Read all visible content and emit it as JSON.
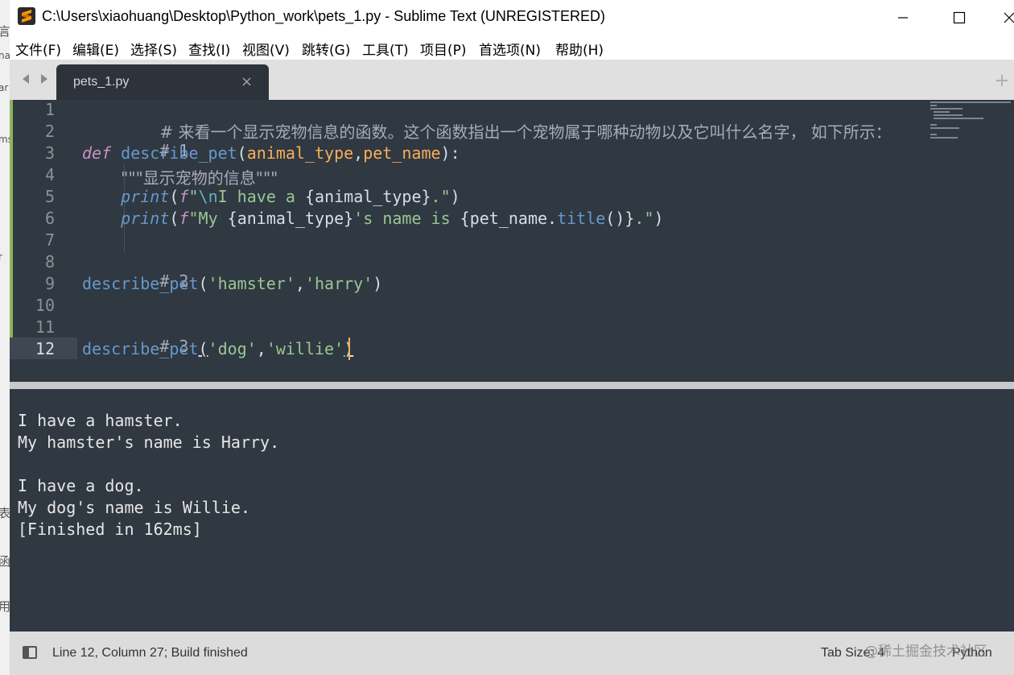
{
  "window": {
    "title": "C:\\Users\\xiaohuang\\Desktop\\Python_work\\pets_1.py - Sublime Text (UNREGISTERED)"
  },
  "menu": [
    "文件(F)",
    "编辑(E)",
    "选择(S)",
    "查找(I)",
    "视图(V)",
    "跳转(G)",
    "工具(T)",
    "项目(P)",
    "首选项(N)",
    "帮助(H)"
  ],
  "tab": {
    "label": "pets_1.py",
    "close": "×"
  },
  "editor": {
    "line_numbers": [
      "1",
      "2",
      "3",
      "4",
      "5",
      "6",
      "7",
      "8",
      "9",
      "10",
      "11",
      "12"
    ],
    "current_line": 12,
    "code": {
      "l1": "# 来看一个显示宠物信息的函数。这个函数指出一个宠物属于哪种动物以及它叫什么名字， 如下所示：",
      "l2": "# 1",
      "l3_kw": "def",
      "l3_fn": "describe_pet",
      "l3_open": "(",
      "l3_p1": "animal_type",
      "l3_comma": ",",
      "l3_p2": "pet_name",
      "l3_close": "):",
      "l4": "\"\"\"显示宠物的信息\"\"\"",
      "l5_fn": "print",
      "l5_open": "(",
      "l5_f": "f",
      "l5_q": "\"",
      "l5_esc": "\\n",
      "l5_s1": "I have a ",
      "l5_b1": "{animal_type}",
      "l5_s2": ".\"",
      "l5_close": ")",
      "l6_fn": "print",
      "l6_open": "(",
      "l6_f": "f",
      "l6_s1": "\"My ",
      "l6_b1": "{animal_type}",
      "l6_s2": "'s name is ",
      "l6_b2a": "{pet_name.",
      "l6_method": "title",
      "l6_b2b": "()}",
      "l6_s3": ".\"",
      "l6_close": ")",
      "l8": "# 2",
      "l9_fn": "describe_pet",
      "l9_open": "(",
      "l9_a1": "'hamster'",
      "l9_comma": ",",
      "l9_a2": "'harry'",
      "l9_close": ")",
      "l11": "# 3",
      "l12_fn": "describe_pet",
      "l12_open": "(",
      "l12_a1": "'dog'",
      "l12_comma": ",",
      "l12_a2a": "'willie",
      "l12_a2b": "'",
      "l12_close": ")"
    }
  },
  "output": {
    "lines": [
      "I have a hamster.",
      "My hamster's name is Harry.",
      "I have a dog.",
      "My dog's name is Willie.",
      "[Finished in 162ms]"
    ]
  },
  "status": {
    "text": "Line 12, Column 27; Build finished",
    "tab_size": "Tab Size: 4",
    "syntax": "Python",
    "watermark": "@稀土掘金技术社区"
  },
  "background_text": [
    "言",
    "na",
    "ar",
    "ms",
    "r",
    "表",
    "函",
    "用"
  ],
  "colors": {
    "editor_bg": "#303841",
    "comment": "#a6acb9",
    "keyword": "#c594c5",
    "function": "#6699cc",
    "parameter": "#f9ae58",
    "string": "#99c794",
    "caret": "#f9ae58"
  },
  "icons": [
    "sublime-text-icon",
    "minimize-icon",
    "maximize-icon",
    "close-icon",
    "chevron-left-icon",
    "chevron-right-icon",
    "plus-icon",
    "panel-toggle-icon"
  ]
}
